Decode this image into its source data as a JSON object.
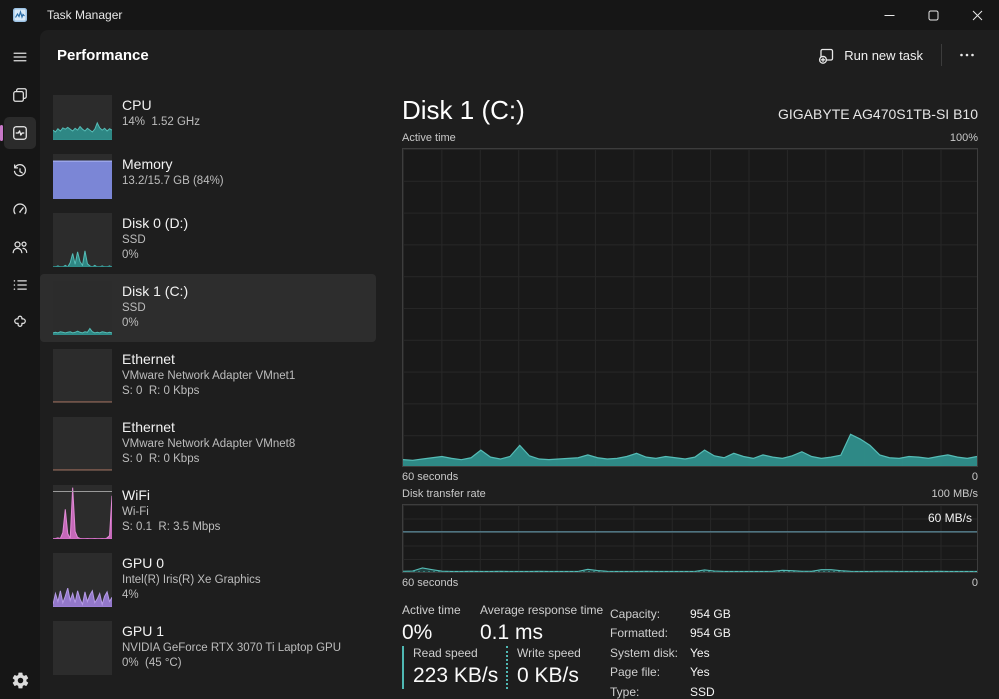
{
  "window": {
    "title": "Task Manager"
  },
  "header": {
    "title": "Performance",
    "run_new_task": "Run new task"
  },
  "icons": {
    "rail": [
      "menu",
      "processes",
      "performance",
      "app-history",
      "startup-apps",
      "users",
      "details",
      "services",
      "settings"
    ],
    "window_controls": [
      "minimize",
      "maximize",
      "close"
    ],
    "more_options": "ellipsis",
    "run_new_task": "window-plus"
  },
  "colors": {
    "selection_accent": "#c878c8",
    "disk_teal_fill": "#2f8f8c",
    "disk_teal_line": "#55bcb6",
    "memory_purple": "#7b86d6",
    "wifi_pink": "#d36ec6",
    "gpu_purple": "#9c7fd8",
    "ethernet_brown": "#7a584c",
    "scale_line_blue": "#56808f"
  },
  "sidebar": {
    "items": [
      {
        "id": "cpu",
        "title": "CPU",
        "lines": [
          "14%  1.52 GHz"
        ],
        "selected": false,
        "chart": {
          "type": "area",
          "color": "#2f8f8c",
          "line": "#55bcb6",
          "values": [
            22,
            18,
            25,
            20,
            27,
            24,
            28,
            24,
            20,
            26,
            22,
            30,
            24,
            20,
            26,
            22,
            18,
            24,
            38,
            27,
            22,
            26,
            20,
            25,
            22
          ]
        }
      },
      {
        "id": "memory",
        "title": "Memory",
        "lines": [
          "13.2/15.7 GB (84%)"
        ],
        "selected": false,
        "chart": {
          "type": "fill",
          "color": "#7b86d6",
          "line": "#9aa4e8",
          "percent": 84
        }
      },
      {
        "id": "disk-0",
        "title": "Disk 0 (D:)",
        "lines": [
          "SSD",
          "0%"
        ],
        "selected": false,
        "chart": {
          "type": "area",
          "color": "#2f8f8c",
          "line": "#55bcb6",
          "values": [
            0,
            0,
            2,
            0,
            0,
            3,
            0,
            8,
            25,
            5,
            28,
            10,
            3,
            30,
            6,
            2,
            0,
            3,
            0,
            0,
            2,
            0,
            0,
            2,
            0
          ]
        }
      },
      {
        "id": "disk-1",
        "title": "Disk 1 (C:)",
        "lines": [
          "SSD",
          "0%"
        ],
        "selected": true,
        "chart": {
          "type": "area",
          "color": "#2f8f8c",
          "line": "#55bcb6",
          "values": [
            4,
            5,
            4,
            6,
            5,
            4,
            5,
            6,
            4,
            5,
            7,
            5,
            4,
            6,
            5,
            12,
            6,
            4,
            5,
            4,
            6,
            5,
            4,
            5,
            4
          ]
        }
      },
      {
        "id": "ethernet-1",
        "title": "Ethernet",
        "lines": [
          "VMware Network Adapter VMnet1",
          "S: 0  R: 0 Kbps"
        ],
        "selected": false,
        "chart": {
          "type": "baseline",
          "color": "#7a584c"
        }
      },
      {
        "id": "ethernet-2",
        "title": "Ethernet",
        "lines": [
          "VMware Network Adapter VMnet8",
          "S: 0  R: 0 Kbps"
        ],
        "selected": false,
        "chart": {
          "type": "baseline",
          "color": "#7a584c"
        }
      },
      {
        "id": "wifi",
        "title": "WiFi",
        "lines": [
          "Wi-Fi",
          "S: 0.1  R: 3.5 Mbps"
        ],
        "selected": false,
        "chart": {
          "type": "spikes",
          "color": "#d36ec6",
          "line": "#e28ad6",
          "topline": true,
          "values": [
            0,
            1,
            2,
            1,
            12,
            55,
            10,
            1,
            95,
            14,
            3,
            1,
            0,
            0,
            1,
            0,
            0,
            1,
            0,
            0,
            1,
            0,
            2,
            6,
            80
          ]
        }
      },
      {
        "id": "gpu-0",
        "title": "GPU 0",
        "lines": [
          "Intel(R) Iris(R) Xe Graphics",
          "4%"
        ],
        "selected": false,
        "chart": {
          "type": "spikes",
          "color": "#9c7fd8",
          "line": "#b59ae6",
          "values": [
            5,
            25,
            10,
            30,
            8,
            20,
            35,
            12,
            25,
            8,
            30,
            15,
            5,
            28,
            10,
            22,
            30,
            8,
            15,
            25,
            5,
            20,
            28,
            10,
            18
          ]
        }
      },
      {
        "id": "gpu-1",
        "title": "GPU 1",
        "lines": [
          "NVIDIA GeForce RTX 3070 Ti Laptop GPU",
          "0%  (45 °C)"
        ],
        "selected": false,
        "chart": {
          "type": "empty",
          "color": "#2f8f8c"
        }
      }
    ]
  },
  "main": {
    "title": "Disk 1 (C:)",
    "device": "GIGABYTE AG470S1TB-SI B10",
    "stats": {
      "active_time": {
        "label": "Active time",
        "value": "0%"
      },
      "avg_response": {
        "label": "Average response time",
        "value": "0.1 ms"
      },
      "read_speed": {
        "label": "Read speed",
        "value": "223 KB/s"
      },
      "write_speed": {
        "label": "Write speed",
        "value": "0 KB/s"
      }
    },
    "details": [
      {
        "label": "Capacity:",
        "value": "954 GB"
      },
      {
        "label": "Formatted:",
        "value": "954 GB"
      },
      {
        "label": "System disk:",
        "value": "Yes"
      },
      {
        "label": "Page file:",
        "value": "Yes"
      },
      {
        "label": "Type:",
        "value": "SSD"
      }
    ]
  },
  "chart_data": [
    {
      "id": "active_time",
      "type": "area",
      "title": "Active time",
      "ymax_label": "100%",
      "xlabel_left": "60 seconds",
      "xlabel_right": "0",
      "ylim": [
        0,
        100
      ],
      "unit": "%",
      "fill": "#2f8f8c",
      "line": "#55bcb6",
      "values": [
        2,
        1.8,
        2.2,
        2.6,
        3,
        2.4,
        2,
        2.6,
        5,
        2.8,
        2.2,
        3,
        6.5,
        3.2,
        2.2,
        2,
        2.2,
        2.4,
        2.6,
        3.5,
        2.6,
        2.2,
        2.4,
        3,
        4,
        2.8,
        2.4,
        3,
        2.6,
        2.2,
        2.8,
        5,
        3.2,
        2.6,
        4,
        3,
        2.4,
        3.5,
        2.8,
        2.4,
        3.2,
        4.5,
        3,
        2.4,
        2.8,
        3.4,
        10,
        8.5,
        6.5,
        3.5,
        2.6,
        2.4,
        3,
        2.8,
        2.4,
        3,
        3.5,
        2.8,
        2.4,
        3
      ]
    },
    {
      "id": "transfer_rate",
      "type": "line",
      "title": "Disk transfer rate",
      "ymax_label": "100 MB/s",
      "xlabel_left": "60 seconds",
      "xlabel_right": "0",
      "ylim": [
        0,
        100
      ],
      "unit": "MB/s",
      "scale_line": {
        "value": 60,
        "label": "60 MB/s",
        "color": "#56808f"
      },
      "series": [
        {
          "name": "read",
          "style": "solid",
          "color": "#55bcb6",
          "area": "rgba(47,143,140,0.35)",
          "values": [
            1,
            1.5,
            6,
            3.5,
            1.2,
            0.8,
            0.8,
            1,
            0.8,
            0.8,
            1,
            0.8,
            0.8,
            0.8,
            1,
            0.8,
            0.8,
            0.8,
            0.8,
            4,
            2.2,
            1,
            0.8,
            0.8,
            0.8,
            1,
            0.8,
            0.8,
            0.8,
            0.8,
            0.8,
            3,
            1.5,
            0.8,
            0.8,
            0.8,
            0.8,
            0.8,
            1,
            2.5,
            2,
            1,
            1,
            3.5,
            3.5,
            2,
            1,
            0.8,
            0.8,
            1,
            1,
            0.8,
            0.8,
            0.8,
            0.8,
            1,
            0.8,
            0.8,
            0.8,
            0.8
          ]
        },
        {
          "name": "write",
          "style": "dotted",
          "color": "#3d918c",
          "values": [
            0.3,
            0.3
          ]
        }
      ]
    }
  ]
}
